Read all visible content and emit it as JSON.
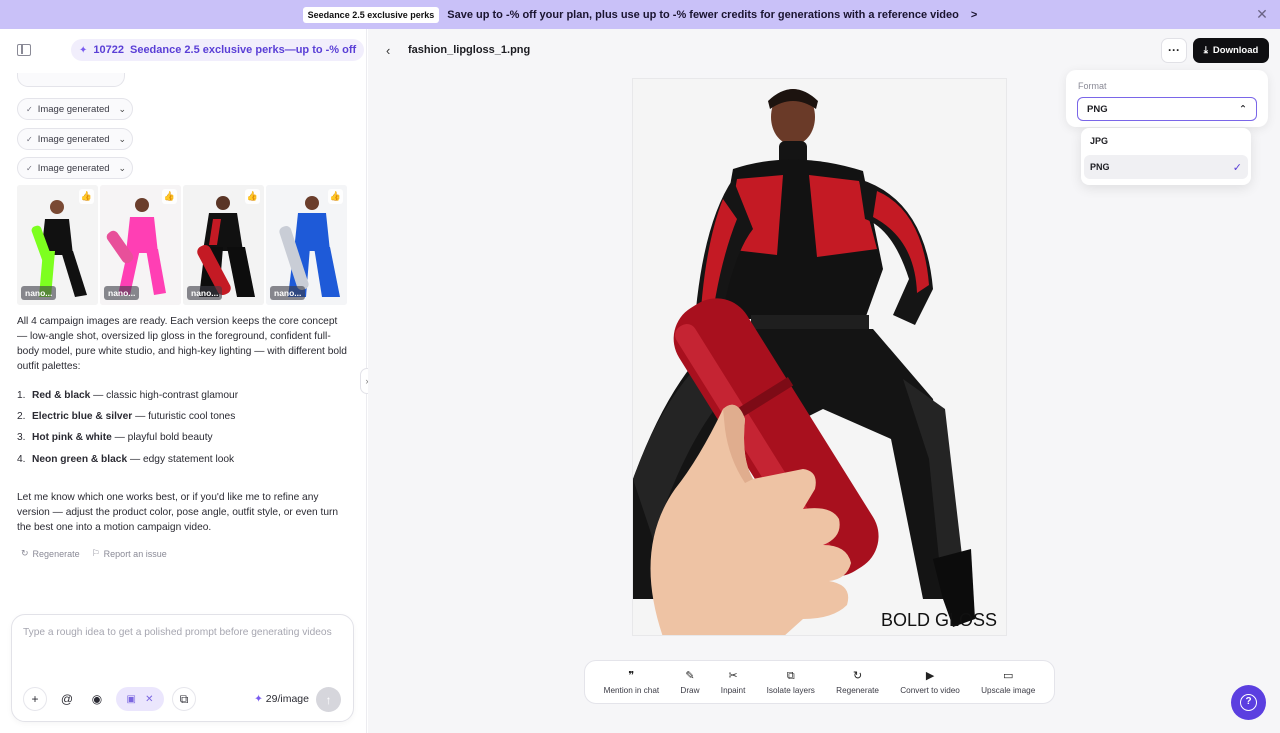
{
  "banner": {
    "badge": "Seedance 2.5 exclusive perks",
    "text": "Save up to -% off your plan, plus use up to -% fewer credits for generations with a reference video",
    "arrow": ">",
    "close": "✕"
  },
  "sidebar": {
    "credits": "10722",
    "promo": "Seedance 2.5 exclusive perks—up to -% off"
  },
  "chat": {
    "generated_chips": [
      "Image generated",
      "Image generated",
      "Image generated"
    ],
    "thumbnails": [
      {
        "tag": "nano...",
        "outfit_color": "#7dff1f",
        "accent": "#111111"
      },
      {
        "tag": "nano...",
        "outfit_color": "#ff3fb4",
        "accent": "#ffffff"
      },
      {
        "tag": "nano...",
        "outfit_color": "#c41a24",
        "accent": "#0d0d0d"
      },
      {
        "tag": "nano...",
        "outfit_color": "#1e5ad8",
        "accent": "#c9cdd6"
      }
    ],
    "intro": "All 4 campaign images are ready. Each version keeps the core concept — low-angle shot, oversized lip gloss in the foreground, confident full-body model, pure white studio, and high-key lighting — with different bold outfit palettes:",
    "list": [
      {
        "num": "1.",
        "bold": "Red & black",
        "rest": " — classic high-contrast glamour"
      },
      {
        "num": "2.",
        "bold": "Electric blue & silver",
        "rest": " — futuristic cool tones"
      },
      {
        "num": "3.",
        "bold": "Hot pink & white",
        "rest": " — playful bold beauty"
      },
      {
        "num": "4.",
        "bold": "Neon green & black",
        "rest": " — edgy statement look"
      }
    ],
    "outro": "Let me know which one works best, or if you'd like me to refine any version — adjust the product color, pose angle, outfit style, or even turn the best one into a motion campaign video.",
    "regenerate": "Regenerate",
    "report": "Report an issue"
  },
  "prompt": {
    "placeholder": "Type a rough idea to get a polished prompt before generating videos",
    "cost": "29/image"
  },
  "viewer": {
    "filename": "fashion_lipgloss_1.png",
    "download": "Download",
    "more": "···",
    "overlay_text": "BOLD GLOSS"
  },
  "format": {
    "label": "Format",
    "selected": "PNG",
    "options": [
      "JPG",
      "PNG"
    ]
  },
  "toolbar": [
    {
      "label": "Mention in chat",
      "icon": "quote-icon"
    },
    {
      "label": "Draw",
      "icon": "pen-icon"
    },
    {
      "label": "Inpaint",
      "icon": "scissors-icon"
    },
    {
      "label": "Isolate layers",
      "icon": "layers-icon"
    },
    {
      "label": "Regenerate",
      "icon": "refresh-icon"
    },
    {
      "label": "Convert to video",
      "icon": "play-icon"
    },
    {
      "label": "Upscale image",
      "icon": "hd-icon"
    }
  ]
}
